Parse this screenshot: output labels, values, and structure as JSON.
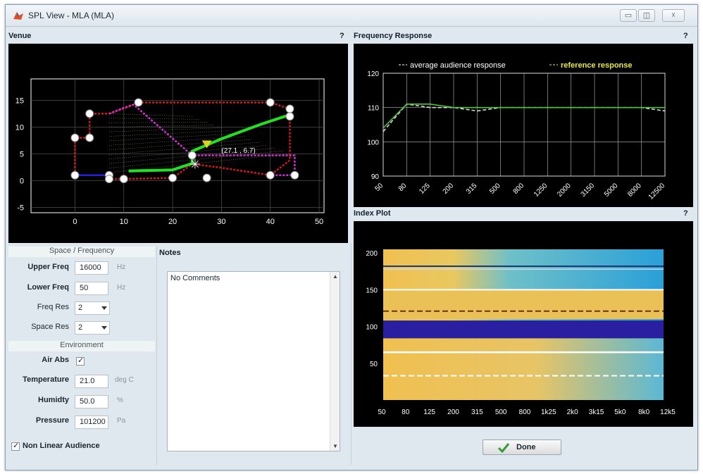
{
  "window": {
    "title": "SPL View - MLA (MLA)",
    "controls": [
      "▭",
      "◫",
      "☓"
    ]
  },
  "venue": {
    "title": "Venue",
    "help": "?",
    "x_ticks": [
      "0",
      "10",
      "20",
      "30",
      "40",
      "50"
    ],
    "y_ticks": [
      "15",
      "10",
      "5",
      "0",
      "-5"
    ],
    "marker_label": "(27.1 , 6.7)"
  },
  "frequency_response": {
    "title": "Frequency Response",
    "help": "?",
    "legend": {
      "average": "average audience response",
      "reference": "reference response"
    }
  },
  "index_plot": {
    "title": "Index Plot",
    "help": "?"
  },
  "space_frequency": {
    "header": "Space / Frequency",
    "upper_freq": {
      "label": "Upper Freq",
      "value": "16000",
      "unit": "Hz"
    },
    "lower_freq": {
      "label": "Lower Freq",
      "value": "50",
      "unit": "Hz"
    },
    "freq_res": {
      "label": "Freq Res",
      "value": "2"
    },
    "space_res": {
      "label": "Space Res",
      "value": "2"
    }
  },
  "environment": {
    "header": "Environment",
    "air_abs": {
      "label": "Air Abs",
      "checked": true
    },
    "temperature": {
      "label": "Temperature",
      "value": "21.0",
      "unit": "deg C"
    },
    "humidity": {
      "label": "Humidty",
      "value": "50.0",
      "unit": "%"
    },
    "pressure": {
      "label": "Pressure",
      "value": "101200",
      "unit": "Pa"
    }
  },
  "non_linear": {
    "label": "Non Linear Audience",
    "checked": true
  },
  "notes": {
    "title": "Notes",
    "text": "No Comments"
  },
  "done_button": {
    "label": "Done"
  },
  "chart_data": [
    {
      "type": "line",
      "title": "Frequency Response",
      "x": [
        "50",
        "80",
        "125",
        "200",
        "315",
        "500",
        "800",
        "1250",
        "2000",
        "3150",
        "5000",
        "8000",
        "12500"
      ],
      "series": [
        {
          "name": "average audience response",
          "color": "#ffffff",
          "values": [
            103,
            111,
            110,
            110,
            109,
            110,
            110,
            110,
            110,
            110,
            110,
            110,
            109
          ]
        },
        {
          "name": "reference response",
          "color": "#e8e84a",
          "values": [
            104,
            111,
            111,
            110,
            110,
            110,
            110,
            110,
            110,
            110,
            110,
            110,
            110
          ]
        }
      ],
      "y_ticks": [
        "120",
        "110",
        "100",
        "90"
      ],
      "ylim": [
        90,
        120
      ],
      "grid": true,
      "legend": "top"
    },
    {
      "type": "heatmap",
      "title": "Index Plot",
      "x_ticks": [
        "50",
        "80",
        "125",
        "200",
        "315",
        "500",
        "800",
        "1k25",
        "2k0",
        "3k15",
        "5k0",
        "8k0",
        "12k5"
      ],
      "y_ticks": [
        "200",
        "150",
        "100",
        "50"
      ],
      "ylim": [
        0,
        205
      ]
    },
    {
      "type": "scatter",
      "title": "Venue",
      "xlim": [
        -9,
        51
      ],
      "ylim": [
        -6,
        19
      ],
      "grid": true,
      "series": [
        {
          "name": "red",
          "color": "#d11a1a",
          "points": [
            [
              0,
              1
            ],
            [
              0,
              8
            ],
            [
              3,
              8
            ],
            [
              3,
              12.5
            ],
            [
              7,
              12.5
            ],
            [
              11,
              13.8
            ],
            [
              13,
              14.6
            ],
            [
              40,
              14.6
            ],
            [
              44,
              13.4
            ],
            [
              44,
              7.5
            ],
            [
              44,
              3.8
            ],
            [
              40,
              1
            ],
            [
              30,
              2.4
            ],
            [
              24,
              3.1
            ],
            [
              20,
              0.5
            ],
            [
              10,
              0.3
            ],
            [
              7,
              0.3
            ]
          ]
        },
        {
          "name": "magenta",
          "color": "#d030d0",
          "points": [
            [
              7,
              12.5
            ],
            [
              10,
              13.6
            ],
            [
              12,
              14.2
            ],
            [
              24,
              4.7
            ],
            [
              30,
              4.7
            ],
            [
              40,
              4.7
            ],
            [
              45,
              4.7
            ],
            [
              45,
              1
            ],
            [
              40,
              1
            ]
          ]
        },
        {
          "name": "green",
          "color": "#22e022",
          "points": [
            [
              11,
              1.8
            ],
            [
              20,
              2
            ],
            [
              24,
              3.2
            ],
            [
              24,
              5.5
            ],
            [
              30,
              7.8
            ],
            [
              38,
              10.5
            ],
            [
              44,
              12.3
            ]
          ]
        },
        {
          "name": "blue",
          "color": "#2020e0",
          "points": [
            [
              0,
              1
            ],
            [
              7,
              1
            ]
          ]
        }
      ]
    }
  ]
}
